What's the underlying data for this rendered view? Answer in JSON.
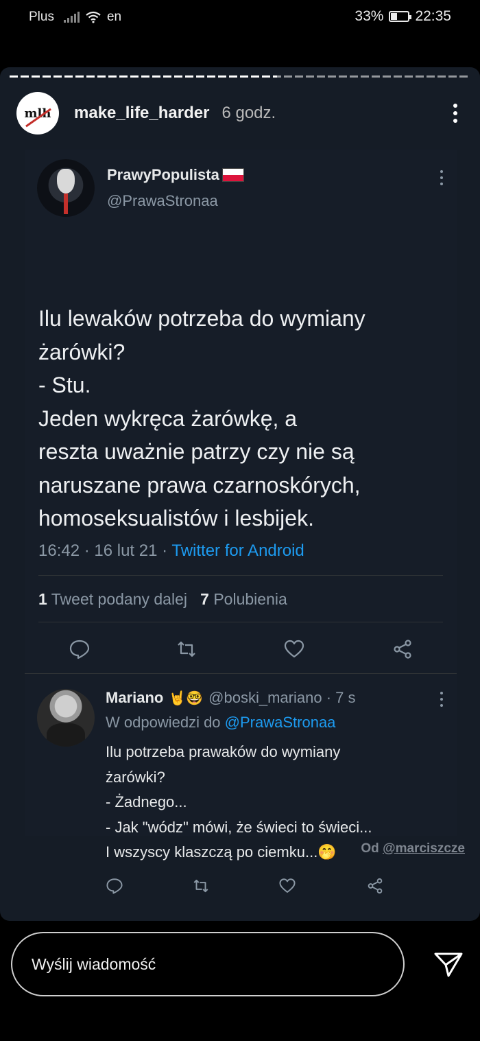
{
  "status_bar": {
    "carrier": "Plus",
    "network": "en",
    "battery": "33%",
    "battery_level": 0.33,
    "time": "22:35"
  },
  "story": {
    "progress": 0.58,
    "username": "make_life_harder",
    "time_ago": "6 godz.",
    "avatar_text": "mlh",
    "credit_prefix": "Od",
    "credit_user": "@marciszcze"
  },
  "tweet": {
    "name": "PrawyPopulista",
    "handle": "@PrawaStronaa",
    "lines": [
      "Ilu lewaków potrzeba do wymiany",
      "żarówki?",
      "- Stu.",
      "Jeden wykręca żarówkę, a",
      "reszta uważnie patrzy czy nie są",
      "naruszane prawa czarnoskórych,",
      "homoseksualistów i lesbijek."
    ],
    "timestamp": "16:42 · 16 lut 21 · ",
    "source": "Twitter for Android",
    "retweets_count": "1",
    "retweets_label": "Tweet podany dalej",
    "likes_count": "7",
    "likes_label": "Polubienia"
  },
  "reply": {
    "name": "Mariano",
    "emojis": "🤘🤓",
    "handle": "@boski_mariano · 7 s",
    "reply_to_prefix": "W odpowiedzi do",
    "reply_to_mention": "@PrawaStronaa",
    "lines": [
      "Ilu potrzeba prawaków do wymiany",
      "żarówki?",
      "- Żadnego...",
      "- Jak \"wódz\" mówi, że świeci to świeci...",
      "I wszyscy klaszczą po ciemku...🤭"
    ]
  },
  "message_bar": {
    "placeholder": "Wyślij wiadomość"
  }
}
